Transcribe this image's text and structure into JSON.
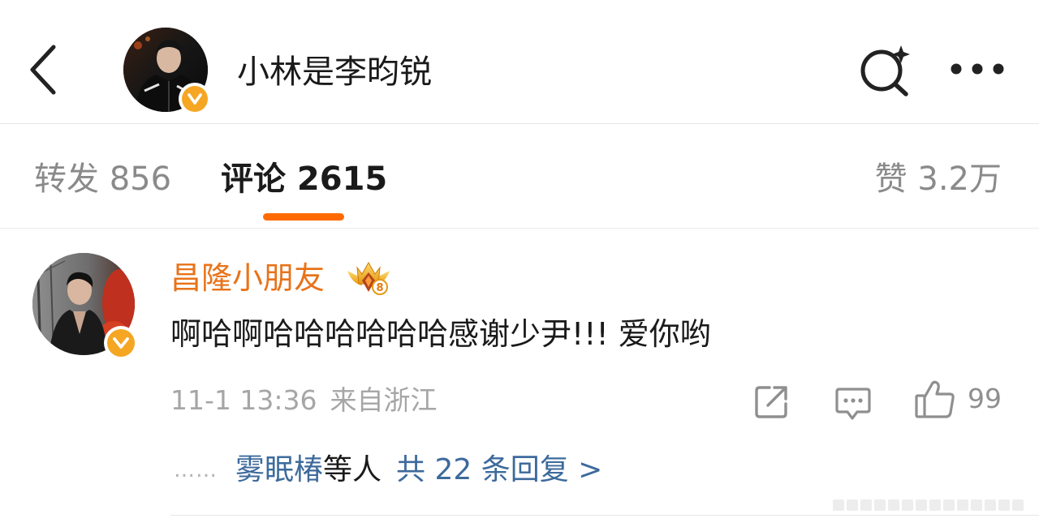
{
  "header": {
    "title": "小林是李昀锐",
    "icons": {
      "back": "chevron-left-icon",
      "search": "search-sparkle-icon",
      "more": "more-horizontal-icon",
      "verified": "verified-v-icon"
    },
    "colors": {
      "verified": "#f5a623"
    }
  },
  "tabs": {
    "repost_label": "转发 856",
    "comment_label": "评论 2615",
    "like_label": "赞 3.2万",
    "active": "comment",
    "accent": "#ff6a00"
  },
  "comment": {
    "username": "昌隆小朋友",
    "username_color": "#e8731a",
    "badge_icon": "crown-level-badge-icon",
    "badge_level": "8",
    "text": "啊哈啊哈哈哈哈哈哈感谢少尹!!! 爱你哟",
    "time": "11-1 13:36",
    "location": "来自浙江",
    "actions": {
      "share_icon": "share-box-icon",
      "comment_icon": "comment-bubble-icon",
      "like_icon": "thumbs-up-icon",
      "like_count": "99"
    },
    "replies": {
      "dots": "……",
      "reply_user": "雾眠椿",
      "mid_text": "等人",
      "total_text": "共 22 条回复 >",
      "link_color": "#3d6a9c"
    }
  }
}
